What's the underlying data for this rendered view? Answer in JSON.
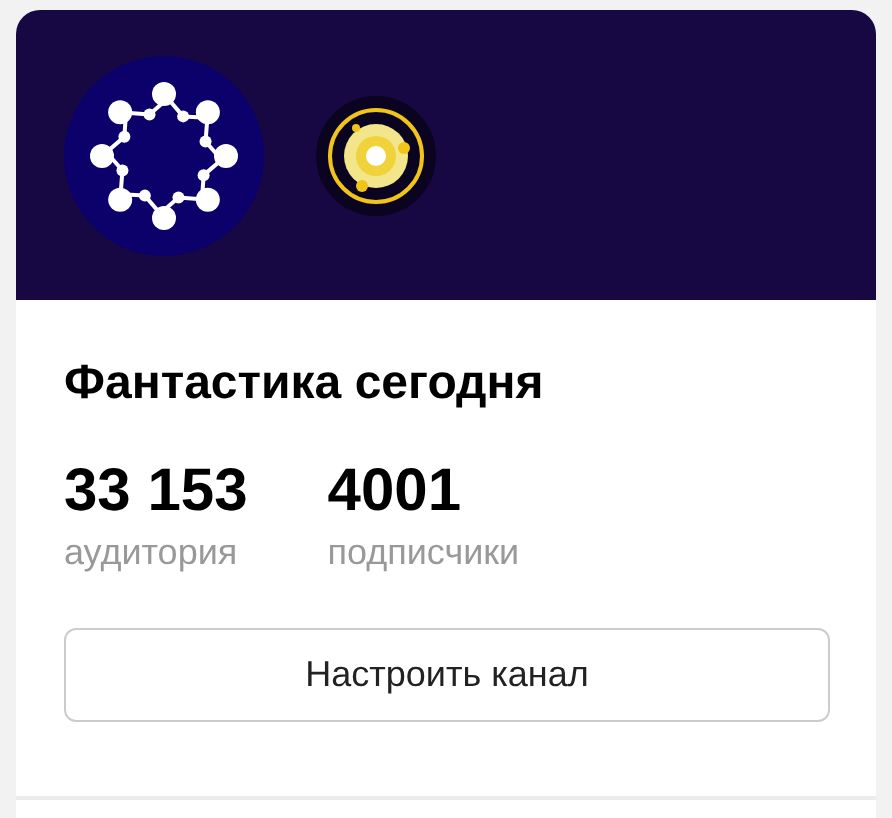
{
  "channel": {
    "name": "Фантастика сегодня"
  },
  "stats": [
    {
      "value": "33 153",
      "label": "аудитория"
    },
    {
      "value": "4001",
      "label": "подписчики"
    }
  ],
  "button": {
    "label": "Настроить канал"
  }
}
